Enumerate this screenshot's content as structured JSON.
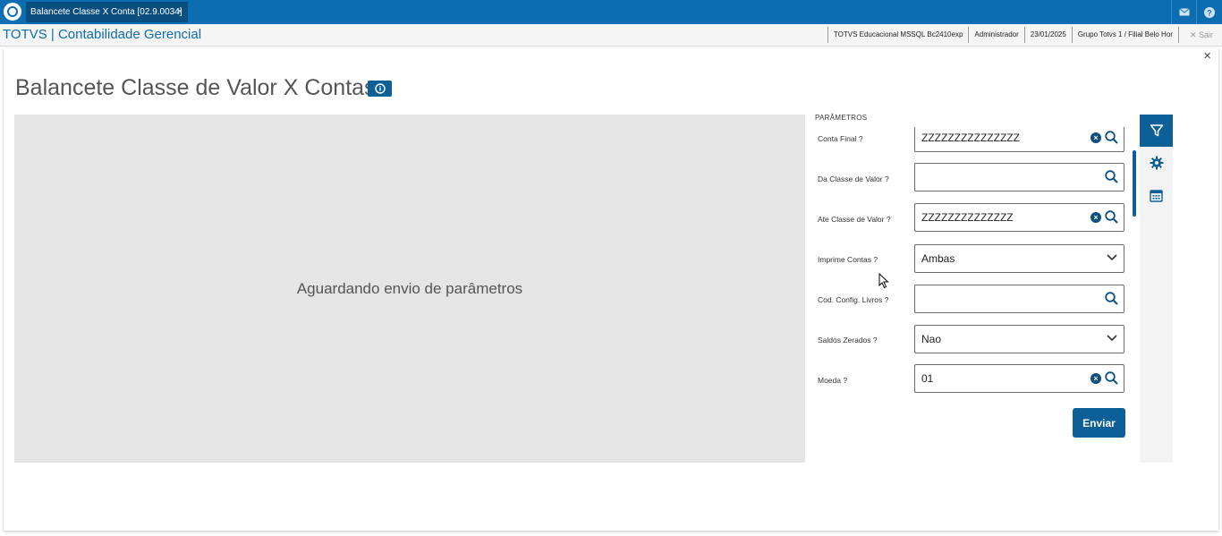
{
  "topbar": {
    "tab_label": "Balancete Classe X Conta [02.9.0034]",
    "tab_close": "×",
    "mail_icon": "mail-icon",
    "help_icon": "help-icon",
    "accent_color": "#0c6eb0"
  },
  "subbar": {
    "app_title": "TOTVS | Contabilidade Gerencial",
    "environment": "TOTVS Educacional MSSQL Bc2410exp",
    "user": "Administrador",
    "date": "23/01/2025",
    "branch": "Grupo Totvs 1 / Filial Belo Hor",
    "exit_label": "Sair"
  },
  "dialog": {
    "close": "×",
    "page_title": "Balancete Classe de Valor X Contas",
    "preview_message": "Aguardando envio de parâmetros",
    "params_title": "PARÂMETROS",
    "fields": [
      {
        "label": "Conta Final ?",
        "value": "ZZZZZZZZZZZZZZZ",
        "type": "lookup-clearable"
      },
      {
        "label": "Da Classe de Valor ?",
        "value": "",
        "type": "lookup"
      },
      {
        "label": "Ate Classe de Valor ?",
        "value": "ZZZZZZZZZZZZZZ",
        "type": "lookup-clearable"
      },
      {
        "label": "Imprime Contas ?",
        "value": "Ambas",
        "type": "select"
      },
      {
        "label": "Cod. Config. Livros ?",
        "value": "",
        "type": "lookup"
      },
      {
        "label": "Saldos Zerados ?",
        "value": "Nao",
        "type": "select"
      },
      {
        "label": "Moeda ?",
        "value": "01",
        "type": "lookup-clearable"
      }
    ],
    "send_label": "Enviar",
    "rail": [
      "filter-icon",
      "gear-icon",
      "calendar-icon"
    ]
  }
}
